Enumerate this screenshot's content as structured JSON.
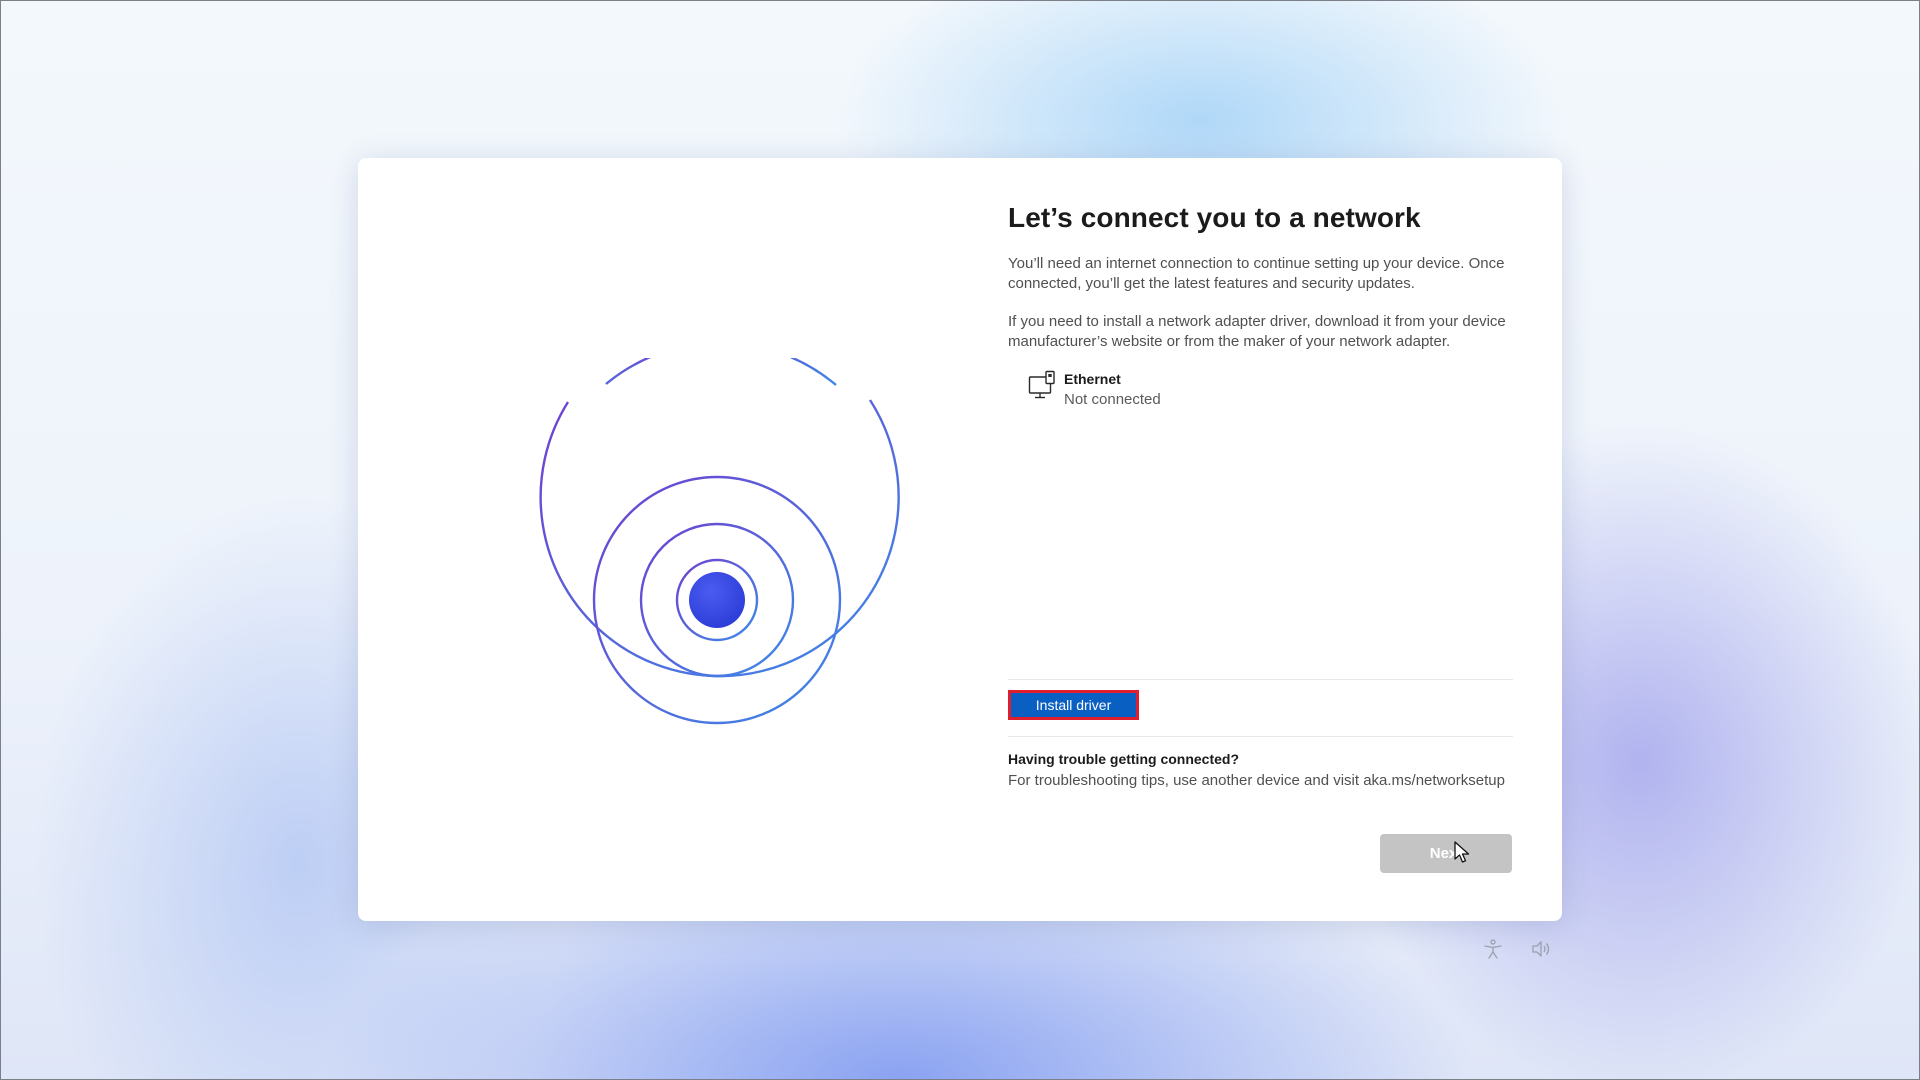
{
  "dialog": {
    "title": "Let’s connect you to a network",
    "paragraph1": "You’ll need an internet connection to continue setting up your device. Once connected, you’ll get the latest features and security updates.",
    "paragraph2": "If you need to install a network adapter driver, download it from your device manufacturer’s website or from the maker of your network adapter."
  },
  "network": {
    "icon": "ethernet-icon",
    "name": "Ethernet",
    "status": "Not connected"
  },
  "actions": {
    "install_driver_label": "Install driver",
    "next_label": "Next"
  },
  "troubleshooting": {
    "heading": "Having trouble getting connected?",
    "text": "For troubleshooting tips, use another device and visit aka.ms/networksetup"
  },
  "colors": {
    "accent": "#0a5fc2",
    "highlight_border": "#e01e2e",
    "next_disabled": "#c4c4c4",
    "ring_purple": "#6a47d6",
    "ring_blue": "#4a7de6"
  },
  "bottom_icons": [
    "accessibility-icon",
    "volume-icon"
  ]
}
